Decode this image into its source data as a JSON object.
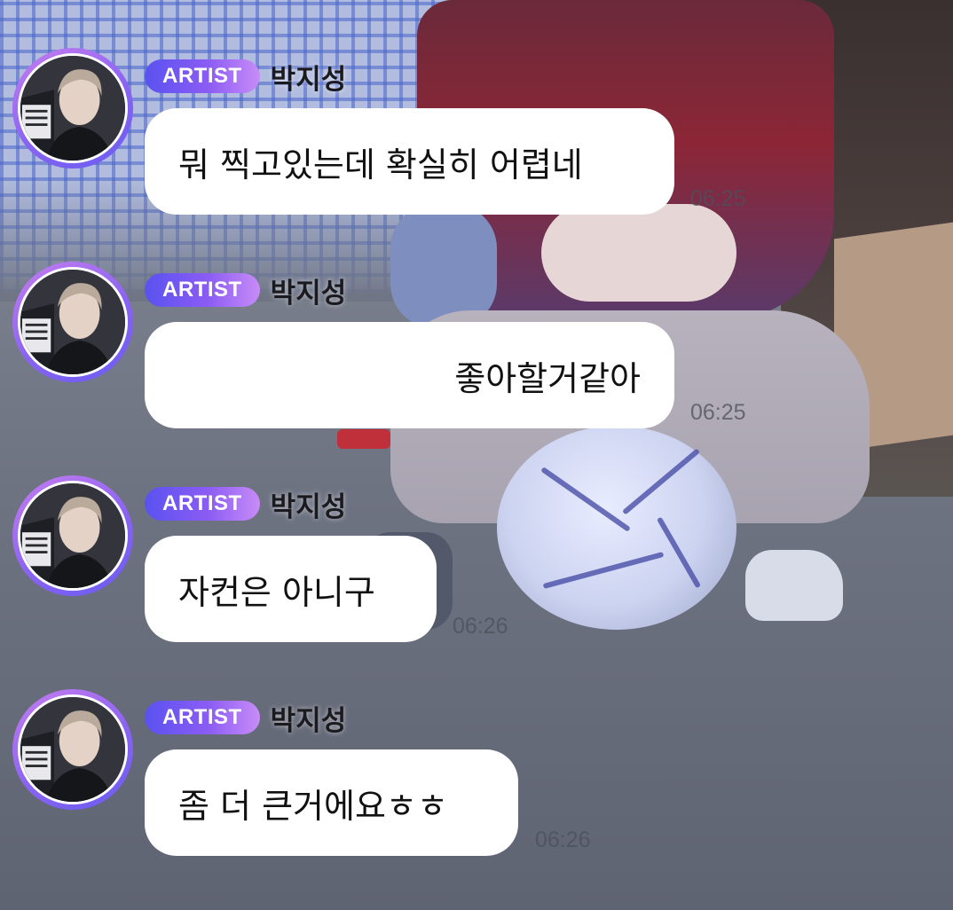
{
  "messages": [
    {
      "badge": "ARTIST",
      "sender": "박지성",
      "text": "뭐 찍고있는데 확실히 어렵네",
      "time": "06:25",
      "avatar_icon": "profile-photo"
    },
    {
      "badge": "ARTIST",
      "sender": "박지성",
      "text": "좋아할거같아",
      "time": "06:25",
      "avatar_icon": "profile-photo"
    },
    {
      "badge": "ARTIST",
      "sender": "박지성",
      "text": "자컨은 아니구",
      "time": "06:26",
      "avatar_icon": "profile-photo"
    },
    {
      "badge": "ARTIST",
      "sender": "박지성",
      "text": "좀 더 큰거에요ㅎㅎ",
      "time": "06:26",
      "avatar_icon": "profile-photo"
    }
  ],
  "colors": {
    "badge_gradient_start": "#5a52f0",
    "badge_gradient_end": "#c88cf7",
    "avatar_ring": "#8a63f2",
    "bubble_bg": "#ffffff"
  }
}
